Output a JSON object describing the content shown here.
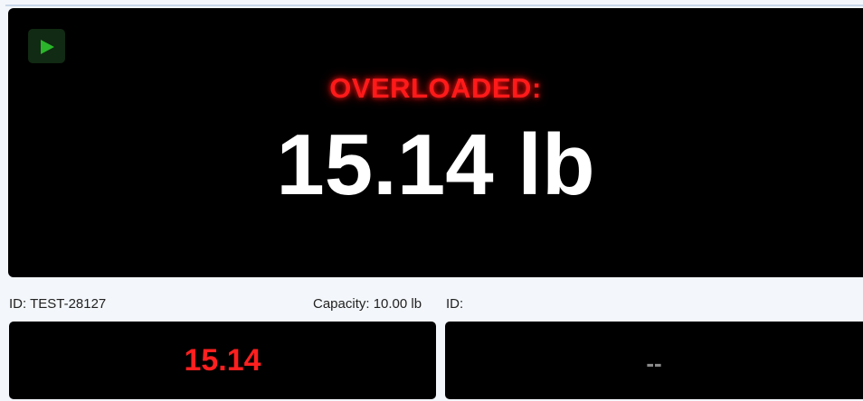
{
  "main_display": {
    "play_icon": "play-icon",
    "status": "OVERLOADED:",
    "reading": "15.14 lb"
  },
  "scale_left": {
    "id_text": "ID: TEST-28127",
    "capacity_text": "Capacity: 10.00 lb",
    "value": "15.14"
  },
  "scale_right": {
    "id_text": "ID:",
    "value": "--"
  },
  "colors": {
    "status_red": "#ff1a1a",
    "play_green": "#2bb52b",
    "panel_bg": "#000000"
  }
}
